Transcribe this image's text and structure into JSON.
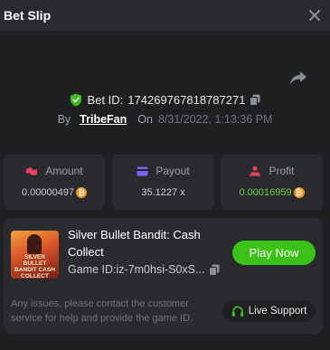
{
  "header": {
    "title": "Bet Slip"
  },
  "bet": {
    "id_label": "Bet ID:",
    "id_value": "174269767818787271",
    "by_label": "By",
    "user": "TribeFan",
    "on_label": "On",
    "date": "8/31/2022, 1:13:36 PM"
  },
  "stats": {
    "amount": {
      "label": "Amount",
      "value": "0.00000497",
      "currency_icon": "btc-icon"
    },
    "payout": {
      "label": "Payout",
      "value": "35.1227 x"
    },
    "profit": {
      "label": "Profit",
      "value": "0.00016959",
      "currency_icon": "btc-icon"
    }
  },
  "game": {
    "thumb_title": "SILVER BULLET BANDIT CASH COLLECT",
    "name": "Silver Bullet Bandit: Cash Collect",
    "id_label": "Game ID: ",
    "id_value": "iz-7m0hsi-S0xS...",
    "play_label": "Play Now"
  },
  "support": {
    "notice": "Any issues, please contact the customer service for help and provide the game ID.",
    "button_label": "Live Support"
  },
  "colors": {
    "accent_green": "#3bc117",
    "profit_green": "#6fcf3c",
    "amount_icon": "#e9415f",
    "payout_icon": "#7b61ff",
    "profit_icon": "#e9415f",
    "btc": "#f7931a"
  }
}
